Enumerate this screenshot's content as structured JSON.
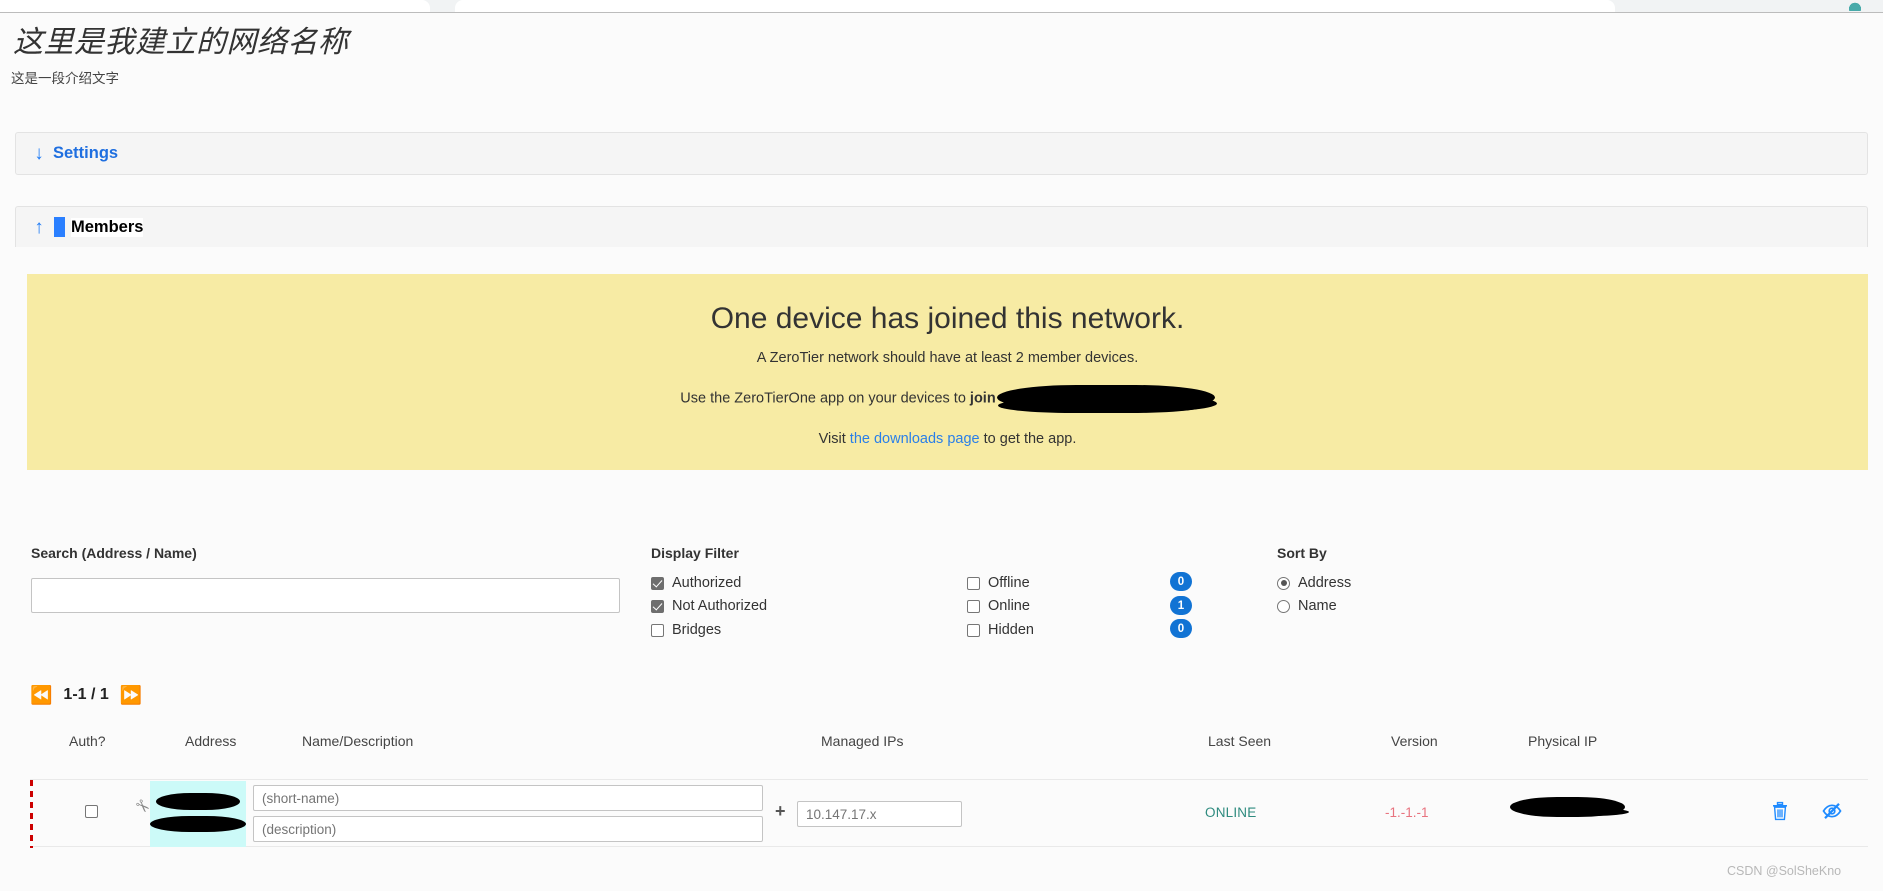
{
  "network": {
    "title": "这里是我建立的网络名称",
    "description": "这是一段介绍文字"
  },
  "panels": {
    "settings": {
      "label": "Settings",
      "arrow": "down-arrow-icon",
      "glyph": "↓"
    },
    "members": {
      "label": "Members",
      "arrow": "up-arrow-icon",
      "glyph": "↑"
    }
  },
  "notice": {
    "heading": "One device has joined this network.",
    "line1": "A ZeroTier network should have at least 2 member devices.",
    "line2_prefix": "Use the ZeroTierOne app on your devices to ",
    "line2_bold": "join",
    "line3_prefix": "Visit ",
    "line3_link": "the downloads page",
    "line3_suffix": " to get the app.",
    "background": "#f7eba4"
  },
  "search": {
    "label": "Search (Address / Name)",
    "value": "",
    "placeholder": ""
  },
  "display_filter": {
    "label": "Display Filter",
    "left_items": [
      {
        "label": "Authorized",
        "checked": true
      },
      {
        "label": "Not Authorized",
        "checked": true
      },
      {
        "label": "Bridges",
        "checked": false
      }
    ],
    "right_items": [
      {
        "label": "Offline",
        "checked": false,
        "count": "0"
      },
      {
        "label": "Online",
        "checked": false,
        "count": "1"
      },
      {
        "label": "Hidden",
        "checked": false,
        "count": "0"
      }
    ],
    "badge_color": "#1173d4"
  },
  "sort_by": {
    "label": "Sort By",
    "options": [
      {
        "label": "Address",
        "selected": true
      },
      {
        "label": "Name",
        "selected": false
      }
    ]
  },
  "pagination": {
    "first_glyph": "⏪",
    "last_glyph": "⏩",
    "text": "1-1 / 1"
  },
  "table": {
    "headers": [
      "Auth?",
      "Address",
      "Name/Description",
      "Managed IPs",
      "Last Seen",
      "Version",
      "Physical IP"
    ],
    "rows": [
      {
        "authorized": false,
        "address": "",
        "name_placeholder": "(short-name)",
        "name_value": "",
        "description_placeholder": "(description)",
        "description_value": "",
        "managed_ip_placeholder": "10.147.17.x",
        "managed_ip_value": "",
        "last_seen": "ONLINE",
        "last_seen_color": "#2e8b7f",
        "version": "-1.-1.-1",
        "version_color": "#e8737f",
        "physical_ip": "",
        "delete_icon": "trash-icon",
        "hide_icon": "eye-slash-icon"
      }
    ]
  },
  "watermark": "CSDN @SolSheKno",
  "colors": {
    "link": "#2a7fe8",
    "panel_link": "#1f6fe0",
    "accent_blue": "#1f7bf5",
    "address_highlight": "#ccfaf8"
  }
}
